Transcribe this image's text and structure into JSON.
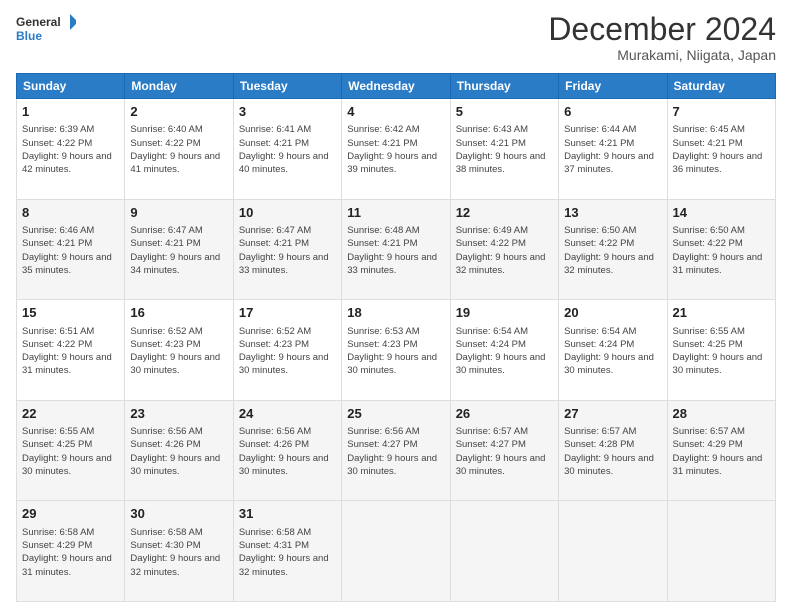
{
  "header": {
    "logo_line1": "General",
    "logo_line2": "Blue",
    "title": "December 2024",
    "location": "Murakami, Niigata, Japan"
  },
  "days_of_week": [
    "Sunday",
    "Monday",
    "Tuesday",
    "Wednesday",
    "Thursday",
    "Friday",
    "Saturday"
  ],
  "weeks": [
    [
      {
        "day": "1",
        "sunrise": "6:39 AM",
        "sunset": "4:22 PM",
        "daylight": "9 hours and 42 minutes."
      },
      {
        "day": "2",
        "sunrise": "6:40 AM",
        "sunset": "4:22 PM",
        "daylight": "9 hours and 41 minutes."
      },
      {
        "day": "3",
        "sunrise": "6:41 AM",
        "sunset": "4:21 PM",
        "daylight": "9 hours and 40 minutes."
      },
      {
        "day": "4",
        "sunrise": "6:42 AM",
        "sunset": "4:21 PM",
        "daylight": "9 hours and 39 minutes."
      },
      {
        "day": "5",
        "sunrise": "6:43 AM",
        "sunset": "4:21 PM",
        "daylight": "9 hours and 38 minutes."
      },
      {
        "day": "6",
        "sunrise": "6:44 AM",
        "sunset": "4:21 PM",
        "daylight": "9 hours and 37 minutes."
      },
      {
        "day": "7",
        "sunrise": "6:45 AM",
        "sunset": "4:21 PM",
        "daylight": "9 hours and 36 minutes."
      }
    ],
    [
      {
        "day": "8",
        "sunrise": "6:46 AM",
        "sunset": "4:21 PM",
        "daylight": "9 hours and 35 minutes."
      },
      {
        "day": "9",
        "sunrise": "6:47 AM",
        "sunset": "4:21 PM",
        "daylight": "9 hours and 34 minutes."
      },
      {
        "day": "10",
        "sunrise": "6:47 AM",
        "sunset": "4:21 PM",
        "daylight": "9 hours and 33 minutes."
      },
      {
        "day": "11",
        "sunrise": "6:48 AM",
        "sunset": "4:21 PM",
        "daylight": "9 hours and 33 minutes."
      },
      {
        "day": "12",
        "sunrise": "6:49 AM",
        "sunset": "4:22 PM",
        "daylight": "9 hours and 32 minutes."
      },
      {
        "day": "13",
        "sunrise": "6:50 AM",
        "sunset": "4:22 PM",
        "daylight": "9 hours and 32 minutes."
      },
      {
        "day": "14",
        "sunrise": "6:50 AM",
        "sunset": "4:22 PM",
        "daylight": "9 hours and 31 minutes."
      }
    ],
    [
      {
        "day": "15",
        "sunrise": "6:51 AM",
        "sunset": "4:22 PM",
        "daylight": "9 hours and 31 minutes."
      },
      {
        "day": "16",
        "sunrise": "6:52 AM",
        "sunset": "4:23 PM",
        "daylight": "9 hours and 30 minutes."
      },
      {
        "day": "17",
        "sunrise": "6:52 AM",
        "sunset": "4:23 PM",
        "daylight": "9 hours and 30 minutes."
      },
      {
        "day": "18",
        "sunrise": "6:53 AM",
        "sunset": "4:23 PM",
        "daylight": "9 hours and 30 minutes."
      },
      {
        "day": "19",
        "sunrise": "6:54 AM",
        "sunset": "4:24 PM",
        "daylight": "9 hours and 30 minutes."
      },
      {
        "day": "20",
        "sunrise": "6:54 AM",
        "sunset": "4:24 PM",
        "daylight": "9 hours and 30 minutes."
      },
      {
        "day": "21",
        "sunrise": "6:55 AM",
        "sunset": "4:25 PM",
        "daylight": "9 hours and 30 minutes."
      }
    ],
    [
      {
        "day": "22",
        "sunrise": "6:55 AM",
        "sunset": "4:25 PM",
        "daylight": "9 hours and 30 minutes."
      },
      {
        "day": "23",
        "sunrise": "6:56 AM",
        "sunset": "4:26 PM",
        "daylight": "9 hours and 30 minutes."
      },
      {
        "day": "24",
        "sunrise": "6:56 AM",
        "sunset": "4:26 PM",
        "daylight": "9 hours and 30 minutes."
      },
      {
        "day": "25",
        "sunrise": "6:56 AM",
        "sunset": "4:27 PM",
        "daylight": "9 hours and 30 minutes."
      },
      {
        "day": "26",
        "sunrise": "6:57 AM",
        "sunset": "4:27 PM",
        "daylight": "9 hours and 30 minutes."
      },
      {
        "day": "27",
        "sunrise": "6:57 AM",
        "sunset": "4:28 PM",
        "daylight": "9 hours and 30 minutes."
      },
      {
        "day": "28",
        "sunrise": "6:57 AM",
        "sunset": "4:29 PM",
        "daylight": "9 hours and 31 minutes."
      }
    ],
    [
      {
        "day": "29",
        "sunrise": "6:58 AM",
        "sunset": "4:29 PM",
        "daylight": "9 hours and 31 minutes."
      },
      {
        "day": "30",
        "sunrise": "6:58 AM",
        "sunset": "4:30 PM",
        "daylight": "9 hours and 32 minutes."
      },
      {
        "day": "31",
        "sunrise": "6:58 AM",
        "sunset": "4:31 PM",
        "daylight": "9 hours and 32 minutes."
      },
      null,
      null,
      null,
      null
    ]
  ],
  "labels": {
    "sunrise": "Sunrise:",
    "sunset": "Sunset:",
    "daylight": "Daylight:"
  }
}
